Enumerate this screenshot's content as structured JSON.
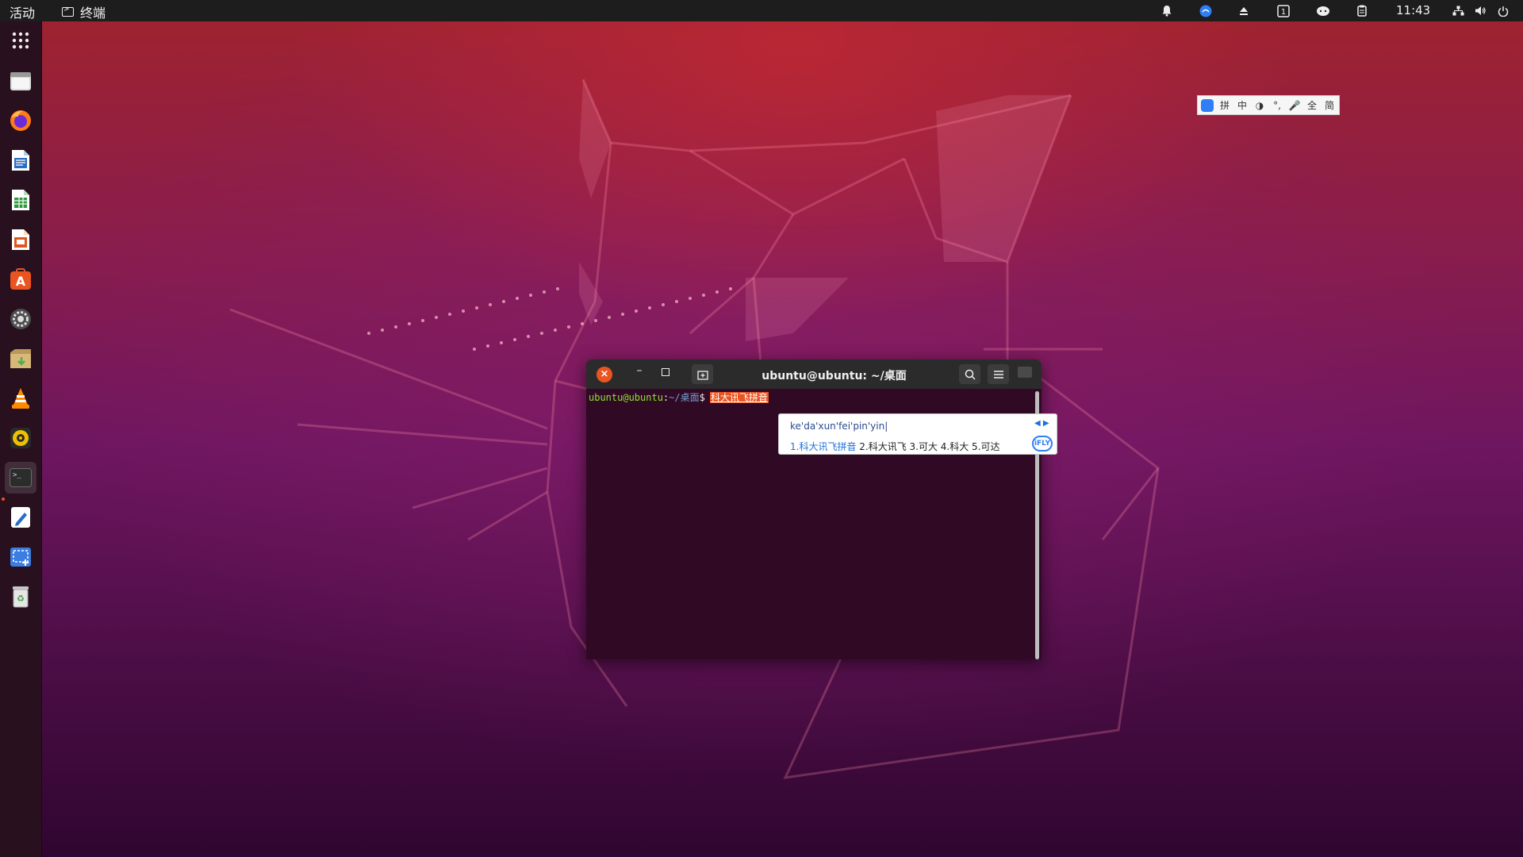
{
  "topbar": {
    "activities": "活动",
    "app_name": "终端",
    "clock": "11:43"
  },
  "dock": {
    "items": [
      "show-apps",
      "files",
      "firefox",
      "libreoffice-writer",
      "libreoffice-calc",
      "libreoffice-impress",
      "ubuntu-software",
      "settings",
      "archive-manager",
      "vlc",
      "rhythmbox",
      "terminal",
      "text-editor",
      "screenshot",
      "trash"
    ]
  },
  "ime_bar": {
    "items": [
      "拼",
      "中",
      "◑",
      "°,",
      "🎤",
      "全",
      "简"
    ]
  },
  "terminal": {
    "title": "ubuntu@ubuntu: ~/桌面",
    "prompt_user": "ubuntu@ubuntu",
    "prompt_colon": ":",
    "prompt_path": "~/桌面",
    "prompt_symbol": "$",
    "preedit": "科大讯飞拼音"
  },
  "candidate_window": {
    "pinyin": "ke'da'xun'fei'pin'yin|",
    "first": "1.科大讯飞拼音",
    "rest": " 2.科大讯飞 3.可大 4.科大 5.可达",
    "logo": "iFLY"
  },
  "colors": {
    "accent": "#e95420",
    "terminal_bg": "#300a24",
    "topbar": "#1d1d1d"
  }
}
